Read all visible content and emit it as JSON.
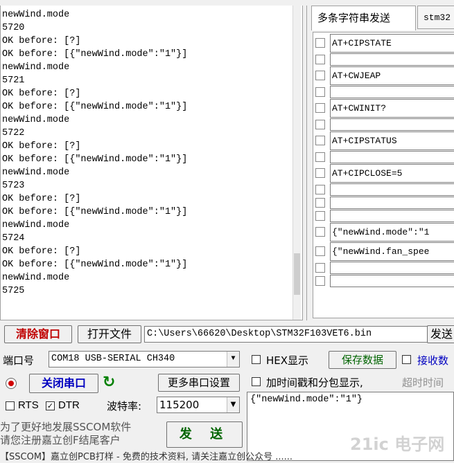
{
  "log": {
    "lines": [
      "newWind.mode",
      "5720",
      "OK before: [?]",
      "OK before: [{\"newWind.mode\":\"1\"}]",
      "newWind.mode",
      "5721",
      "OK before: [?]",
      "OK before: [{\"newWind.mode\":\"1\"}]",
      "newWind.mode",
      "5722",
      "OK before: [?]",
      "OK before: [{\"newWind.mode\":\"1\"}]",
      "newWind.mode",
      "5723",
      "OK before: [?]",
      "OK before: [{\"newWind.mode\":\"1\"}]",
      "newWind.mode",
      "5724",
      "OK before: [?]",
      "OK before: [{\"newWind.mode\":\"1\"}]",
      "newWind.mode",
      "5725"
    ]
  },
  "tabs": {
    "multi_send": "多条字符串发送",
    "stm32": "stm32"
  },
  "multi_send": {
    "rows": [
      {
        "text": "AT+CIPSTATE"
      },
      {
        "text": ""
      },
      {
        "text": "AT+CWJEAP"
      },
      {
        "text": ""
      },
      {
        "text": "AT+CWINIT?"
      },
      {
        "text": ""
      },
      {
        "text": "AT+CIPSTATUS"
      },
      {
        "text": ""
      },
      {
        "text": "AT+CIPCLOSE=5"
      },
      {
        "text": ""
      },
      {
        "text": ""
      },
      {
        "text": ""
      },
      {
        "text": "{\"newWind.mode\":\"1"
      },
      {
        "text": "{\"newWind.fan_spee"
      },
      {
        "text": ""
      },
      {
        "text": ""
      }
    ]
  },
  "toolbar": {
    "clear": "清除窗口",
    "open_file": "打开文件",
    "file_path": "C:\\Users\\66620\\Desktop\\STM32F103VET6.bin",
    "send_file": "发送"
  },
  "port": {
    "label": "端口号",
    "value": "COM18 USB-SERIAL CH340",
    "close": "关闭串口",
    "more": "更多串口设置",
    "rts": "RTS",
    "dtr": "DTR",
    "rts_checked": false,
    "dtr_checked": true,
    "baud_label": "波特率:",
    "baud": "115200"
  },
  "options": {
    "hex_display": "HEX显示",
    "save_data": "保存数据",
    "receive_to": "接收数",
    "timestamp": "加时间戳和分包显示,",
    "timeout": "超时时间"
  },
  "send": {
    "text": "{\"newWind.mode\":\"1\"}",
    "button": "发 送"
  },
  "promo": {
    "line1": "为了更好地发展SSCOM软件",
    "line2": "请您注册嘉立创F结尾客户"
  },
  "status": {
    "text": "【SSCOM】嘉立创PCB打样  -  免费的技术资料, 请关注嘉立创公众号 ......"
  },
  "watermark": "21ic 电子网",
  "colors": {
    "clear": "#c00000",
    "save": "#006400",
    "receive": "#0000c0"
  }
}
